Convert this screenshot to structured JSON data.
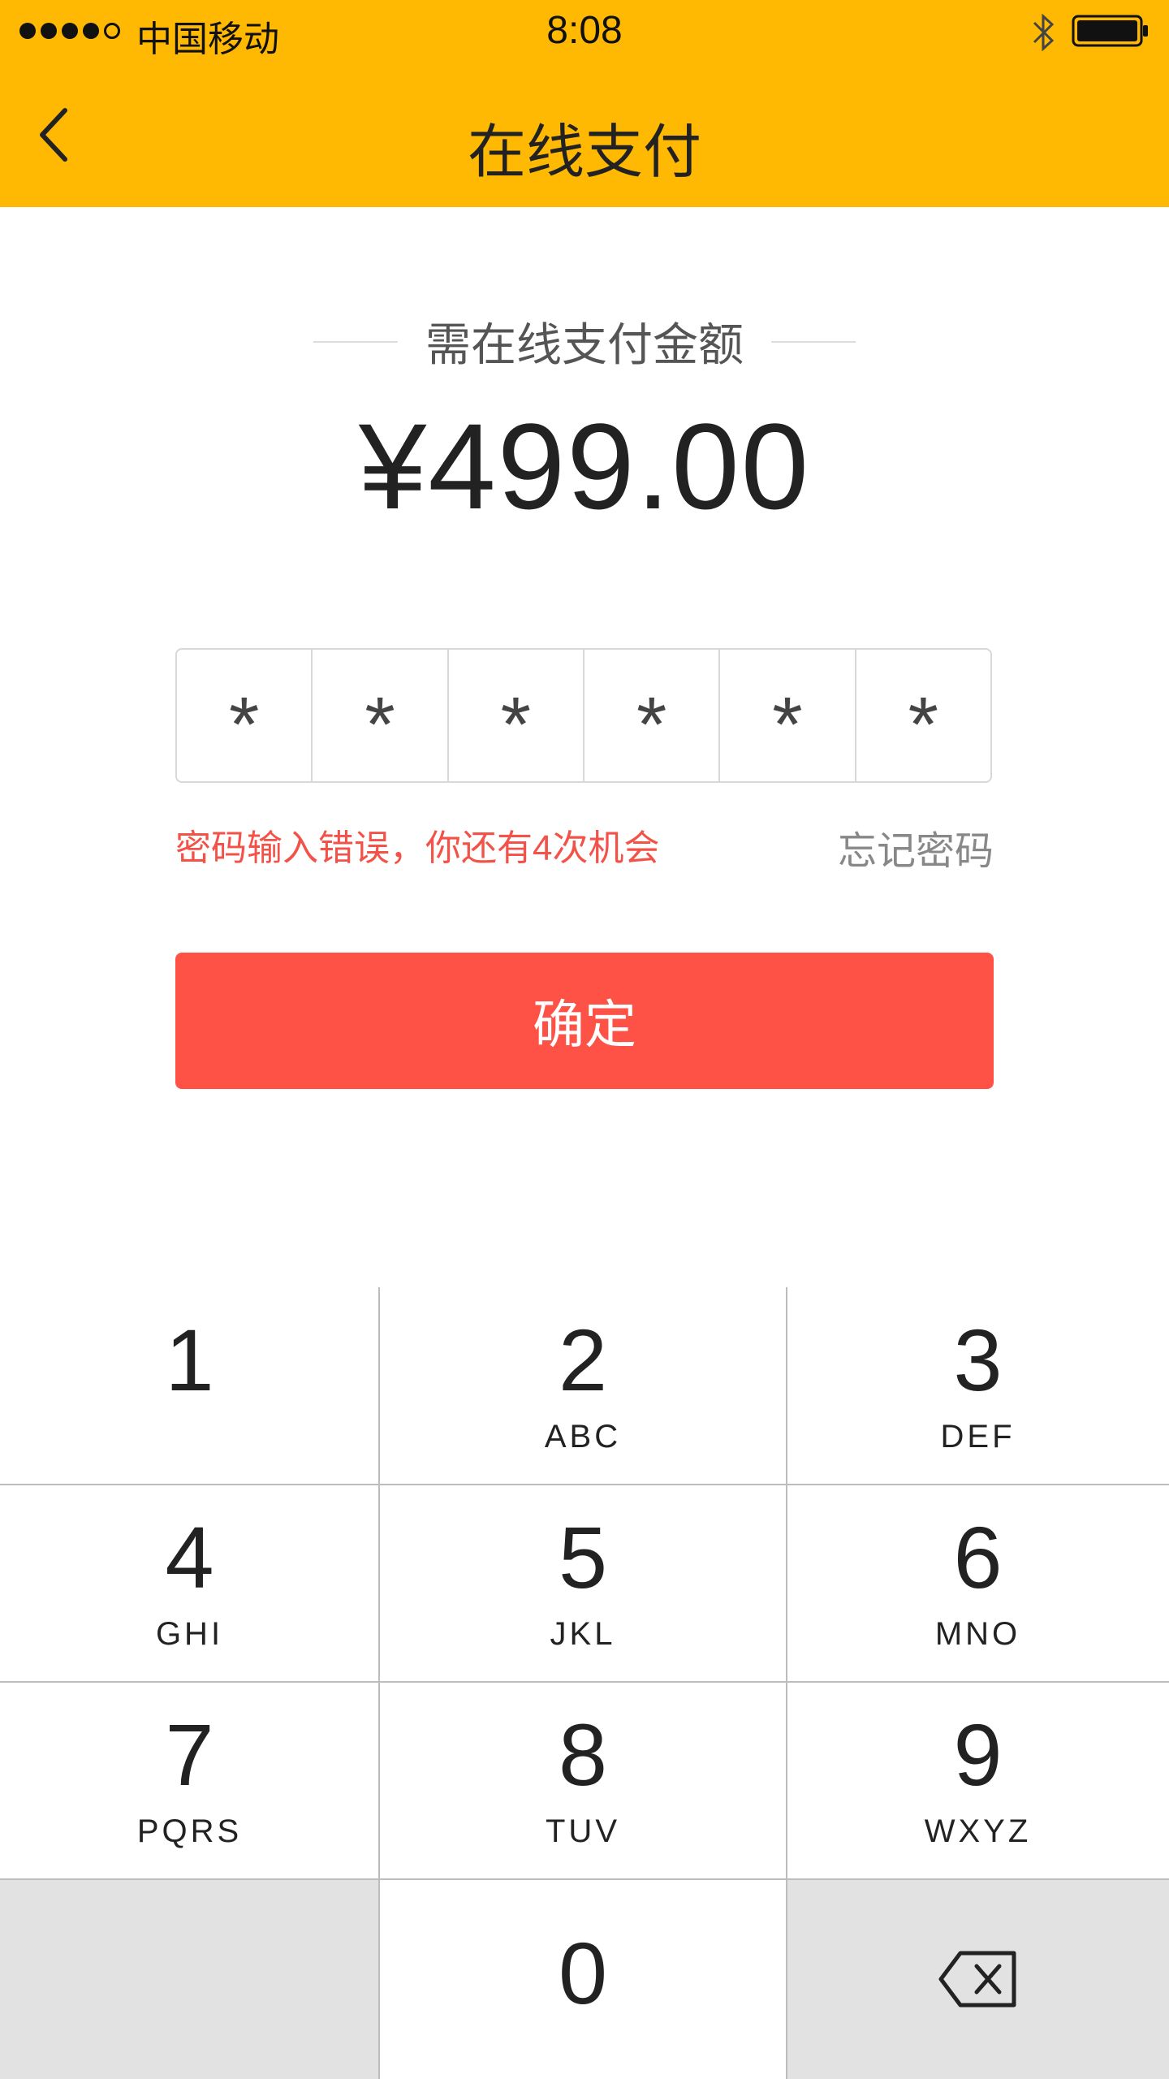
{
  "status_bar": {
    "carrier": "中国移动",
    "time": "8:08"
  },
  "header": {
    "title": "在线支付"
  },
  "payment": {
    "amount_label": "需在线支付金额",
    "amount": "¥499.00"
  },
  "password": {
    "cells": [
      "*",
      "*",
      "*",
      "*",
      "*",
      "*"
    ],
    "error_message": "密码输入错误，你还有4次机会",
    "forgot_label": "忘记密码"
  },
  "confirm_label": "确定",
  "keypad": {
    "keys": [
      {
        "digit": "1",
        "letters": ""
      },
      {
        "digit": "2",
        "letters": "ABC"
      },
      {
        "digit": "3",
        "letters": "DEF"
      },
      {
        "digit": "4",
        "letters": "GHI"
      },
      {
        "digit": "5",
        "letters": "JKL"
      },
      {
        "digit": "6",
        "letters": "MNO"
      },
      {
        "digit": "7",
        "letters": "PQRS"
      },
      {
        "digit": "8",
        "letters": "TUV"
      },
      {
        "digit": "9",
        "letters": "WXYZ"
      },
      {
        "digit": "0",
        "letters": ""
      }
    ]
  },
  "colors": {
    "header_bg": "#FFB903",
    "error_text": "#F35249",
    "confirm_bg": "#FF5247",
    "key_gray": "#E2E2E2"
  }
}
